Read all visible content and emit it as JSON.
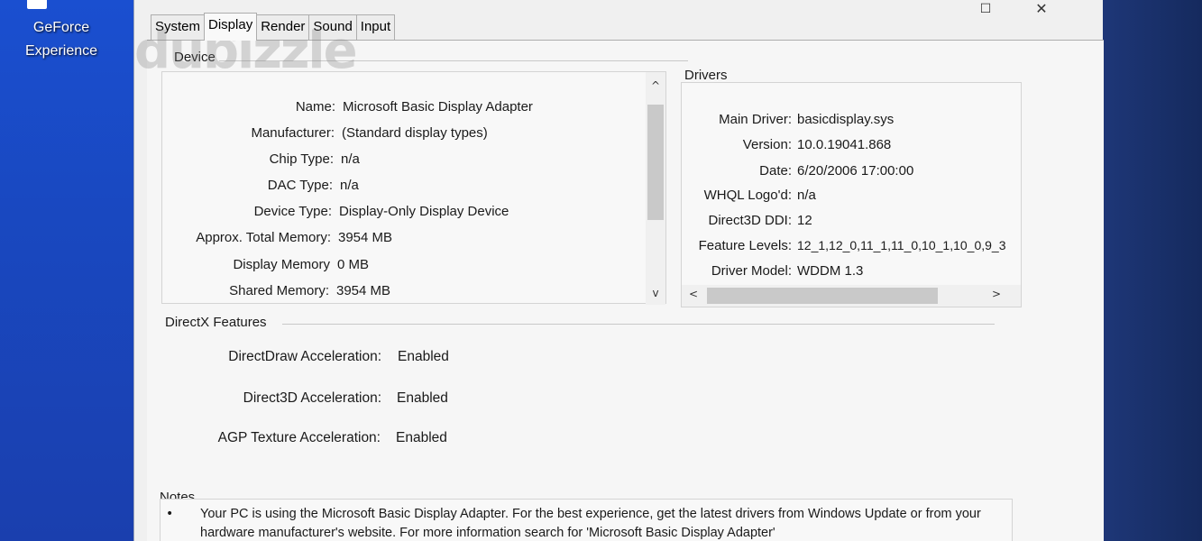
{
  "desktop": {
    "icon_label_line1": "GeForce",
    "icon_label_line2": "Experience"
  },
  "watermark": "dubizzle",
  "window": {
    "controls": {
      "maximize": "☐",
      "close": "✕"
    }
  },
  "tabs": [
    {
      "label": "System"
    },
    {
      "label": "Display"
    },
    {
      "label": "Render"
    },
    {
      "label": "Sound"
    },
    {
      "label": "Input"
    }
  ],
  "device": {
    "title": "Device",
    "rows": [
      {
        "key": "Name:",
        "value": "Microsoft Basic Display Adapter"
      },
      {
        "key": "Manufacturer:",
        "value": "(Standard display types)"
      },
      {
        "key": "Chip Type:",
        "value": "n/a"
      },
      {
        "key": "DAC Type:",
        "value": "n/a"
      },
      {
        "key": "Device Type:",
        "value": "Display-Only Display Device"
      },
      {
        "key": "Approx. Total Memory:",
        "value": "3954 MB"
      },
      {
        "key": "Display Memory",
        "value": "0 MB"
      },
      {
        "key": "Shared Memory:",
        "value": "3954 MB"
      }
    ]
  },
  "drivers": {
    "title": "Drivers",
    "rows": [
      {
        "key": "Main Driver:",
        "value": "basicdisplay.sys"
      },
      {
        "key": "Version:",
        "value": "10.0.19041.868"
      },
      {
        "key": "Date:",
        "value": "6/20/2006 17:00:00"
      },
      {
        "key": "WHQL Logo'd:",
        "value": "n/a"
      },
      {
        "key": "Direct3D DDI:",
        "value": "12"
      },
      {
        "key": "Feature Levels:",
        "value": "12_1,12_0,11_1,11_0,10_1,10_0,9_3"
      },
      {
        "key": "Driver Model:",
        "value": "WDDM 1.3"
      }
    ]
  },
  "directx": {
    "title": "DirectX Features",
    "rows": [
      {
        "key": "DirectDraw Acceleration:",
        "value": "Enabled"
      },
      {
        "key": "Direct3D Acceleration:",
        "value": "Enabled"
      },
      {
        "key": "AGP Texture Acceleration:",
        "value": "Enabled"
      }
    ]
  },
  "notes": {
    "title": "Notes",
    "bullet": "•",
    "text": "Your PC is using the Microsoft Basic Display Adapter. For the best experience, get the latest drivers from Windows Update or from your hardware manufacturer's website. For more information search for 'Microsoft Basic Display Adapter'"
  },
  "scroll": {
    "up": "^",
    "down": "v",
    "left": "<",
    "right": ">"
  }
}
